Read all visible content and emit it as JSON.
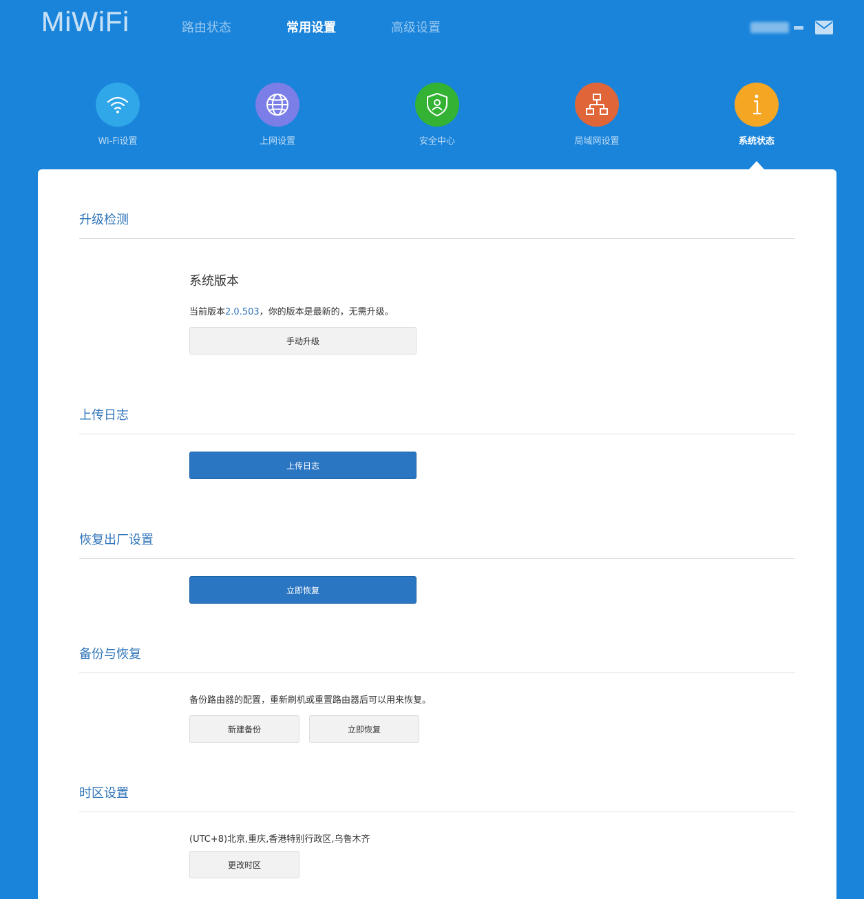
{
  "brand": {
    "logo_text": "MiWiFi"
  },
  "topnav": {
    "items": [
      {
        "label": "路由状态",
        "active": false
      },
      {
        "label": "常用设置",
        "active": true
      },
      {
        "label": "高级设置",
        "active": false
      }
    ]
  },
  "user": {
    "mail_icon": "mail-icon"
  },
  "categories": [
    {
      "label": "Wi-Fi设置",
      "icon": "wifi-icon",
      "color": "#2fa7e8",
      "active": false
    },
    {
      "label": "上网设置",
      "icon": "globe-icon",
      "color": "#7b7ee6",
      "active": false
    },
    {
      "label": "安全中心",
      "icon": "shield-icon",
      "color": "#33b233",
      "active": false
    },
    {
      "label": "局域网设置",
      "icon": "network-icon",
      "color": "#e0663a",
      "active": false
    },
    {
      "label": "系统状态",
      "icon": "info-icon",
      "color": "#f5a623",
      "active": true
    }
  ],
  "sections": {
    "upgrade": {
      "title": "升级检测",
      "subtitle": "系统版本",
      "status_prefix": "当前版本",
      "version": "2.0.503",
      "status_suffix": "，你的版本是最新的，无需升级。",
      "button": "手动升级"
    },
    "log": {
      "title": "上传日志",
      "button": "上传日志"
    },
    "factory": {
      "title": "恢复出厂设置",
      "button": "立即恢复"
    },
    "backup": {
      "title": "备份与恢复",
      "description": "备份路由器的配置，重新刷机或重置路由器后可以用来恢复。",
      "new_button": "新建备份",
      "restore_button": "立即恢复"
    },
    "timezone": {
      "title": "时区设置",
      "value": "(UTC+8)北京,重庆,香港特别行政区,乌鲁木齐",
      "button": "更改时区"
    }
  },
  "colors": {
    "background": "#1a84db",
    "accent": "#2f74b9",
    "primary_button": "#2a76c2"
  }
}
